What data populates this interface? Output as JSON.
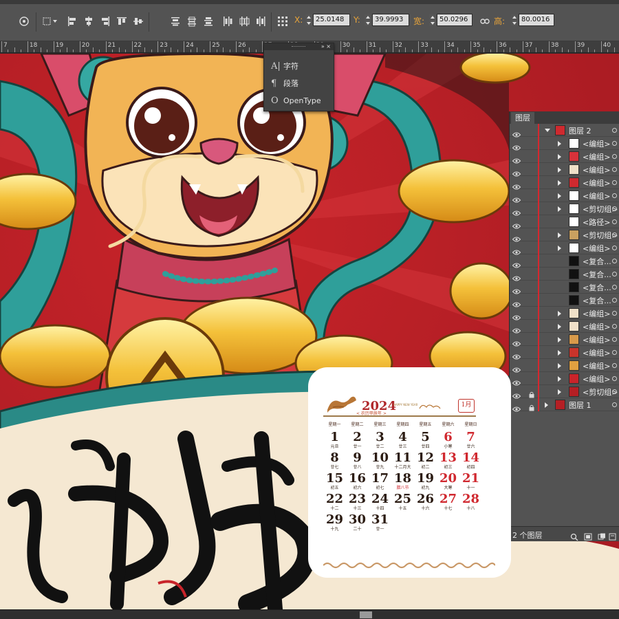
{
  "toolbar": {
    "x_label": "X:",
    "x_value": "25.0148",
    "y_label": "Y:",
    "y_value": "39.9993",
    "w_label": "宽:",
    "w_value": "50.0296",
    "h_label": "高:",
    "h_value": "80.0016"
  },
  "ruler": {
    "labels": [
      "7",
      "18",
      "19",
      "20",
      "21",
      "22",
      "23",
      "24",
      "25",
      "26",
      "27",
      "28",
      "29",
      "30",
      "31",
      "32",
      "33",
      "34",
      "35",
      "36",
      "37",
      "38",
      "39",
      "40"
    ]
  },
  "char_panel": {
    "items": [
      "字符",
      "段落",
      "OpenType"
    ]
  },
  "layers_panel": {
    "tab": "图层",
    "layers": [
      {
        "name": "图层 2"
      },
      {
        "name": "<编组>"
      },
      {
        "name": "<编组>"
      },
      {
        "name": "<编组>"
      },
      {
        "name": "<编组>"
      },
      {
        "name": "<编组>"
      },
      {
        "name": "<剪切组>"
      },
      {
        "name": "<路径>"
      },
      {
        "name": "<剪切组>"
      },
      {
        "name": "<编组>"
      },
      {
        "name": "<复合..."
      },
      {
        "name": "<复合..."
      },
      {
        "name": "<复合..."
      },
      {
        "name": "<复合..."
      },
      {
        "name": "<编组>"
      },
      {
        "name": "<编组>"
      },
      {
        "name": "<编组>"
      },
      {
        "name": "<编组>"
      },
      {
        "name": "<编组>"
      },
      {
        "name": "<编组>"
      },
      {
        "name": "<剪切组>"
      },
      {
        "name": "图层 1"
      }
    ],
    "footer_count": "2 个图层"
  },
  "calendar": {
    "year_logo": "2024",
    "happy_new_year": "HAPPY NEW YEAR",
    "lunar_year": "< 农历甲辰年 >",
    "month": "1月",
    "weekdays": [
      "星期一",
      "星期二",
      "星期三",
      "星期四",
      "星期五",
      "星期六",
      "星期日"
    ],
    "days": [
      {
        "d": "1",
        "l": "元旦"
      },
      {
        "d": "2",
        "l": "廿一"
      },
      {
        "d": "3",
        "l": "廿二"
      },
      {
        "d": "4",
        "l": "廿三"
      },
      {
        "d": "5",
        "l": "廿四"
      },
      {
        "d": "6",
        "l": "小寒"
      },
      {
        "d": "7",
        "l": "廿六"
      },
      {
        "d": "8",
        "l": "廿七"
      },
      {
        "d": "9",
        "l": "廿八"
      },
      {
        "d": "10",
        "l": "廿九"
      },
      {
        "d": "11",
        "l": "十二月大"
      },
      {
        "d": "12",
        "l": "初二"
      },
      {
        "d": "13",
        "l": "初三"
      },
      {
        "d": "14",
        "l": "初四"
      },
      {
        "d": "15",
        "l": "初五"
      },
      {
        "d": "16",
        "l": "初六"
      },
      {
        "d": "17",
        "l": "初七"
      },
      {
        "d": "18",
        "l": "腊八节"
      },
      {
        "d": "19",
        "l": "初九"
      },
      {
        "d": "20",
        "l": "大寒"
      },
      {
        "d": "21",
        "l": "十一"
      },
      {
        "d": "22",
        "l": "十二"
      },
      {
        "d": "23",
        "l": "十三"
      },
      {
        "d": "24",
        "l": "十四"
      },
      {
        "d": "25",
        "l": "十五"
      },
      {
        "d": "26",
        "l": "十六"
      },
      {
        "d": "27",
        "l": "十七"
      },
      {
        "d": "28",
        "l": "十八"
      },
      {
        "d": "29",
        "l": "十九"
      },
      {
        "d": "30",
        "l": "二十"
      },
      {
        "d": "31",
        "l": "廿一"
      }
    ]
  },
  "colors": {
    "accent_orange": "#e8a43a",
    "calendar_red": "#d0282f",
    "layer_bar": "#d8262e"
  }
}
